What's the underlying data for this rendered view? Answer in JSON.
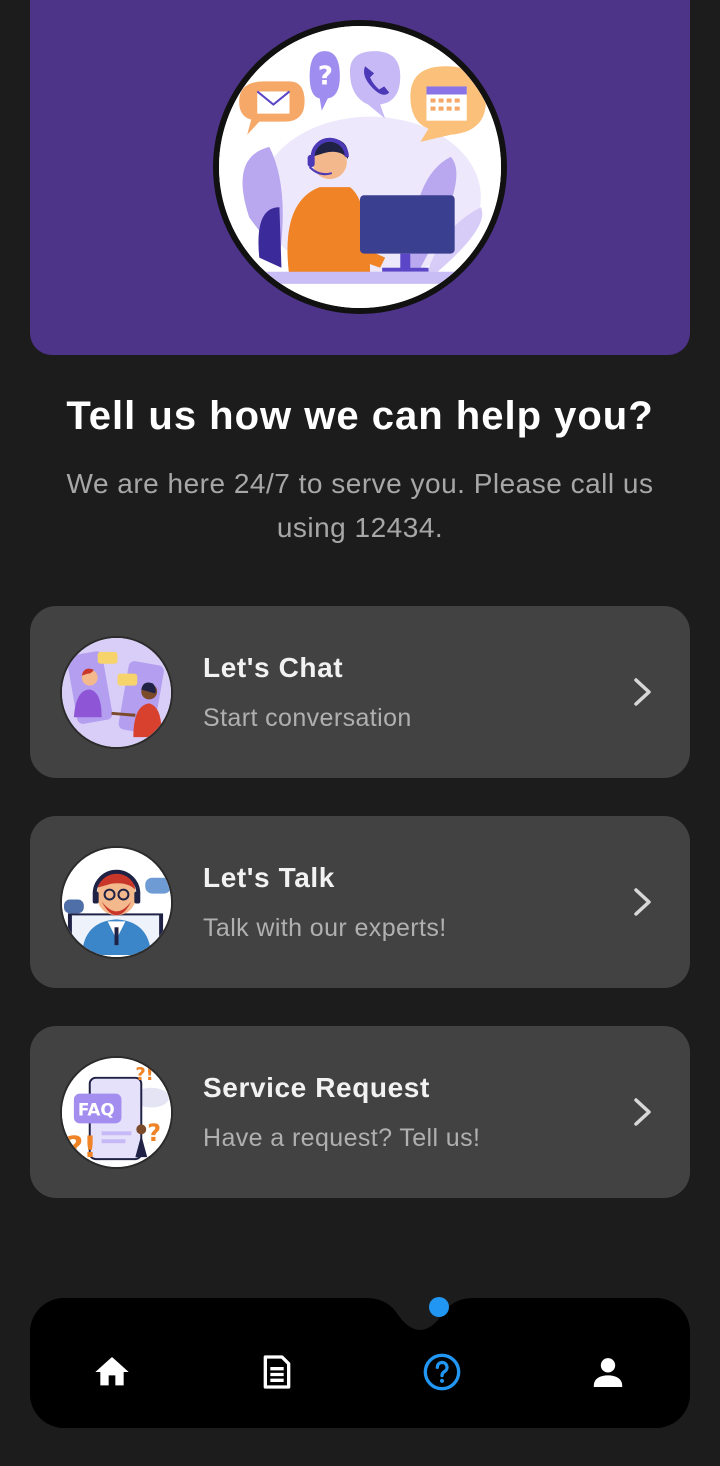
{
  "header": {
    "title": "Tell us how we can help you?",
    "subtitle": "We are here 24/7 to serve you. Please call us using 12434."
  },
  "options": [
    {
      "title": "Let's Chat",
      "description": "Start conversation",
      "icon": "chat-illustration"
    },
    {
      "title": "Let's Talk",
      "description": "Talk with our experts!",
      "icon": "support-agent-illustration"
    },
    {
      "title": "Service Request",
      "description": "Have a request? Tell us!",
      "icon": "faq-illustration"
    }
  ],
  "illustration_text": {
    "faq_label": "FAQ"
  },
  "bottom_nav": {
    "items": [
      "home-icon",
      "document-icon",
      "help-icon",
      "profile-icon"
    ],
    "active": "help-icon"
  },
  "colors": {
    "background": "#1c1c1c",
    "hero": "#4e3489",
    "card": "#424242",
    "accent": "#2196f3",
    "nav": "#000000"
  }
}
